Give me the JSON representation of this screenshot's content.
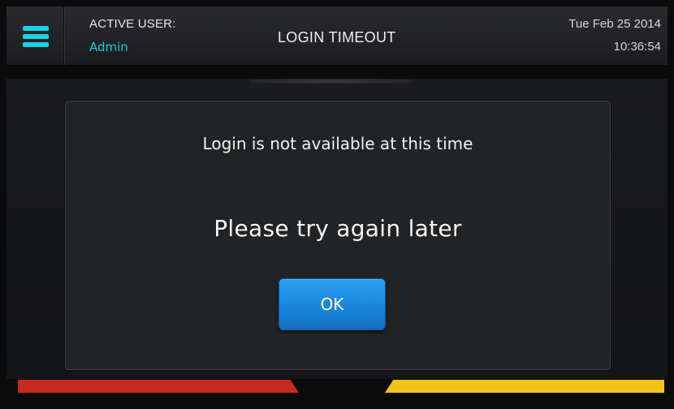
{
  "header": {
    "menu_icon": "hamburger-menu-icon",
    "active_user_label": "ACTIVE USER:",
    "active_user_name": "Admin",
    "title": "LOGIN TIMEOUT",
    "date": "Tue Feb 25 2014",
    "time": "10:36:54"
  },
  "dialog": {
    "message": "Login is not available at this time",
    "submessage": "Please try again later",
    "ok_label": "OK"
  },
  "colors": {
    "accent": "#19d3e6",
    "button_blue": "#1a86dc",
    "status_red": "#c62a1f",
    "status_yellow": "#f2c11a"
  }
}
